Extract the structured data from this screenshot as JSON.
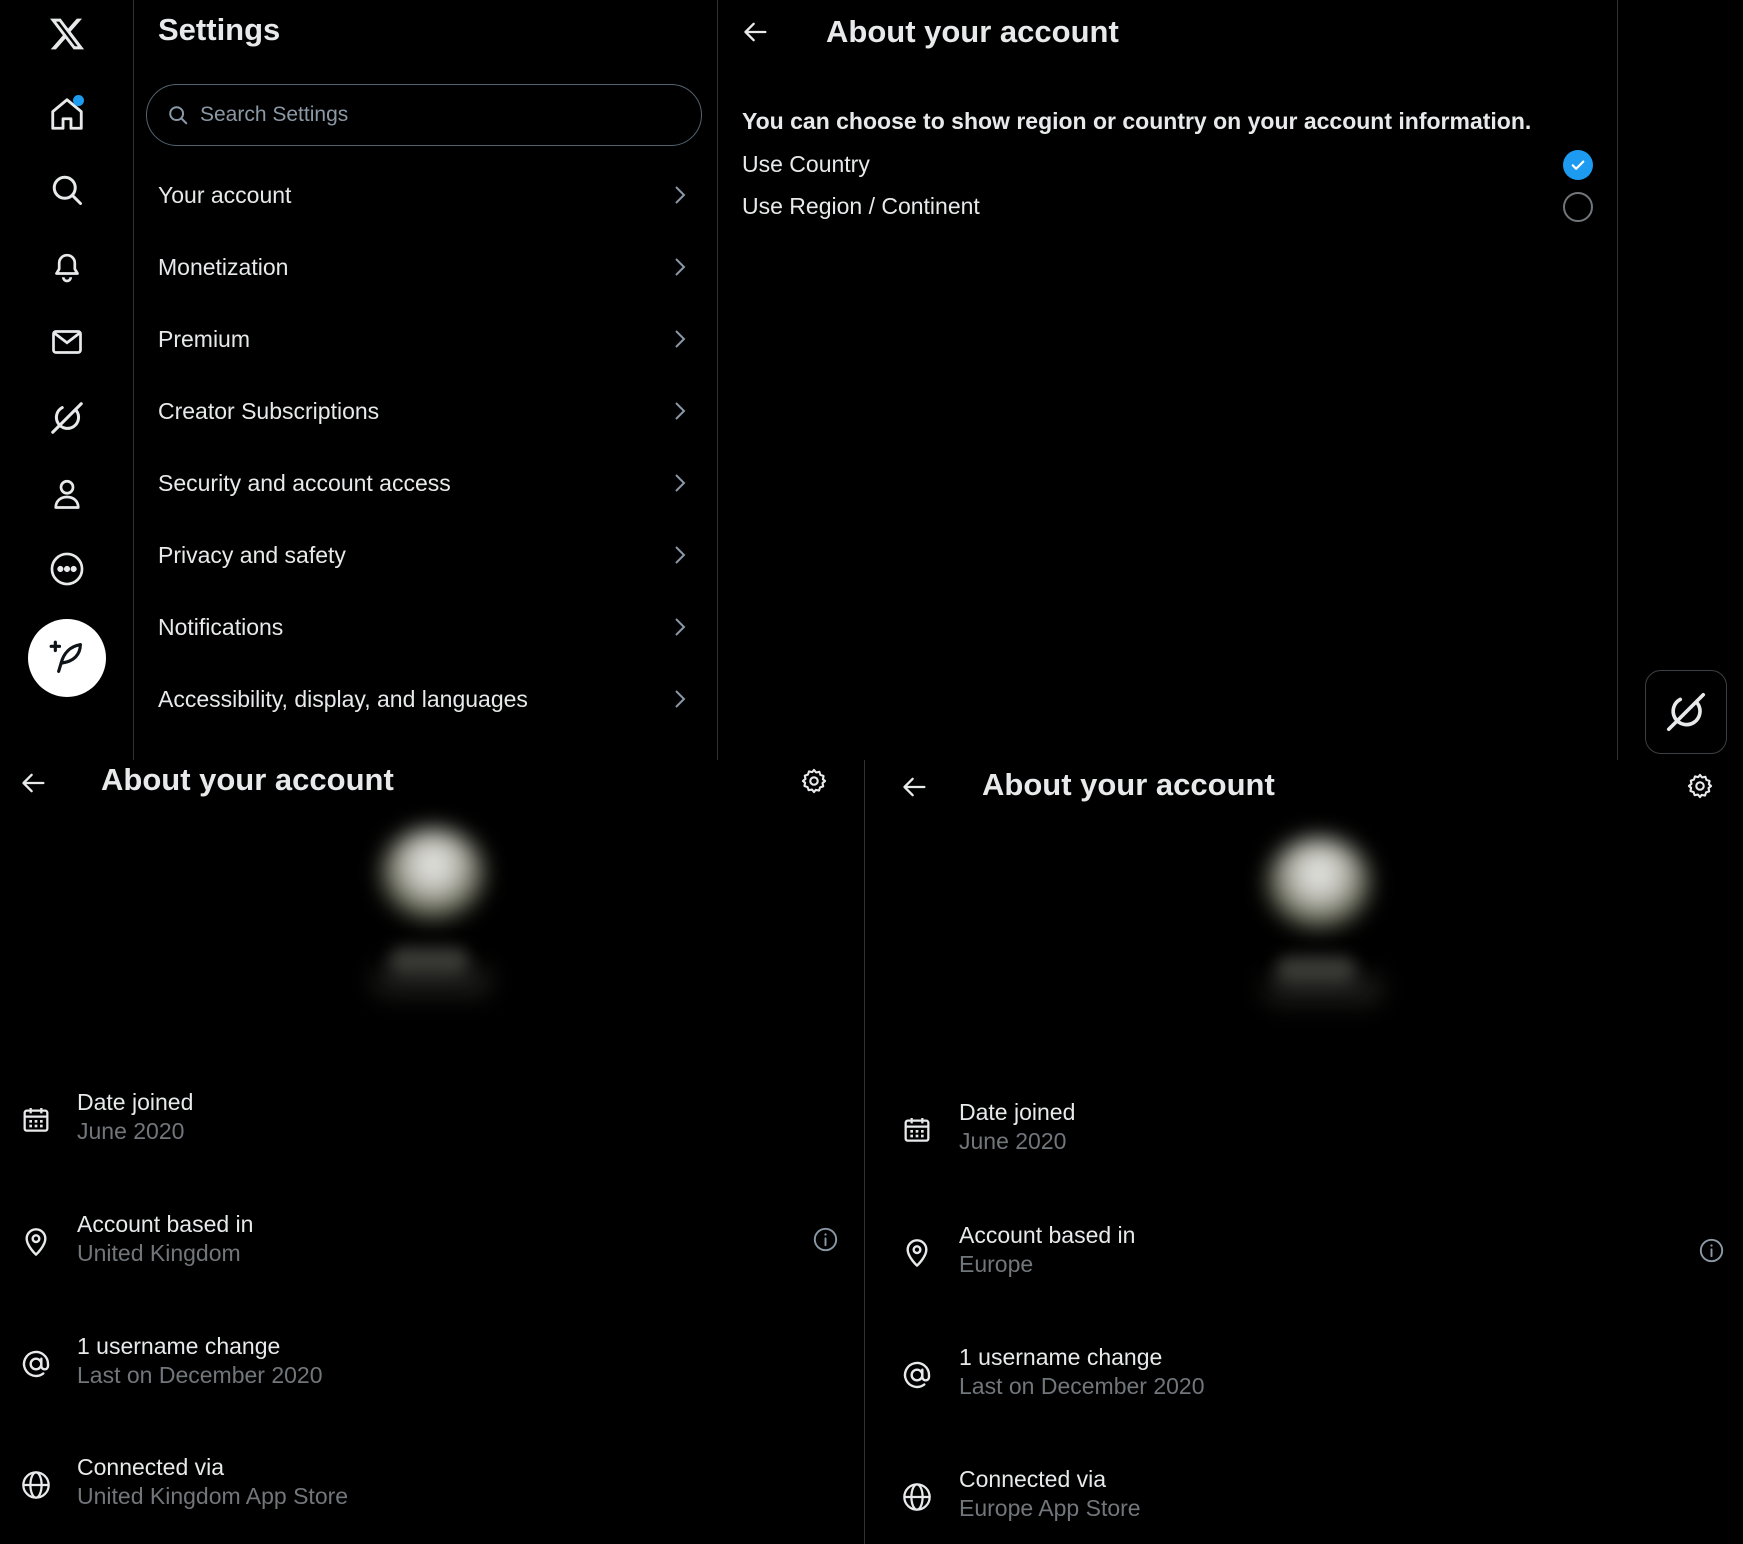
{
  "sidebar": {
    "icons": [
      "x-logo-icon",
      "home-icon",
      "search-icon",
      "bell-icon",
      "mail-icon",
      "grok-icon",
      "profile-icon",
      "more-icon"
    ],
    "post_button_icon": "feather-plus-icon",
    "accent": "#1d9bf0"
  },
  "settings": {
    "title": "Settings",
    "search_placeholder": "Search Settings",
    "items": [
      {
        "label": "Your account"
      },
      {
        "label": "Monetization"
      },
      {
        "label": "Premium"
      },
      {
        "label": "Creator Subscriptions"
      },
      {
        "label": "Security and account access"
      },
      {
        "label": "Privacy and safety"
      },
      {
        "label": "Notifications"
      },
      {
        "label": "Accessibility, display, and languages"
      }
    ]
  },
  "about_settings": {
    "title": "About your account",
    "prompt": "You can choose to show region or country on your account information.",
    "options": [
      {
        "label": "Use Country",
        "selected": true
      },
      {
        "label": "Use Region / Continent",
        "selected": false
      }
    ]
  },
  "about_country": {
    "title": "About your account",
    "rows": [
      {
        "icon": "calendar-icon",
        "label": "Date joined",
        "value": "June 2020"
      },
      {
        "icon": "location-pin-icon",
        "label": "Account based in",
        "value": "United Kingdom"
      },
      {
        "icon": "at-sign-icon",
        "label": "1 username change",
        "value": "Last on December 2020"
      },
      {
        "icon": "globe-icon",
        "label": "Connected via",
        "value": "United Kingdom App Store"
      }
    ]
  },
  "about_region": {
    "title": "About your account",
    "rows": [
      {
        "icon": "calendar-icon",
        "label": "Date joined",
        "value": "June 2020"
      },
      {
        "icon": "location-pin-icon",
        "label": "Account based in",
        "value": "Europe"
      },
      {
        "icon": "at-sign-icon",
        "label": "1 username change",
        "value": "Last on December 2020"
      },
      {
        "icon": "globe-icon",
        "label": "Connected via",
        "value": "Europe App Store"
      }
    ]
  }
}
